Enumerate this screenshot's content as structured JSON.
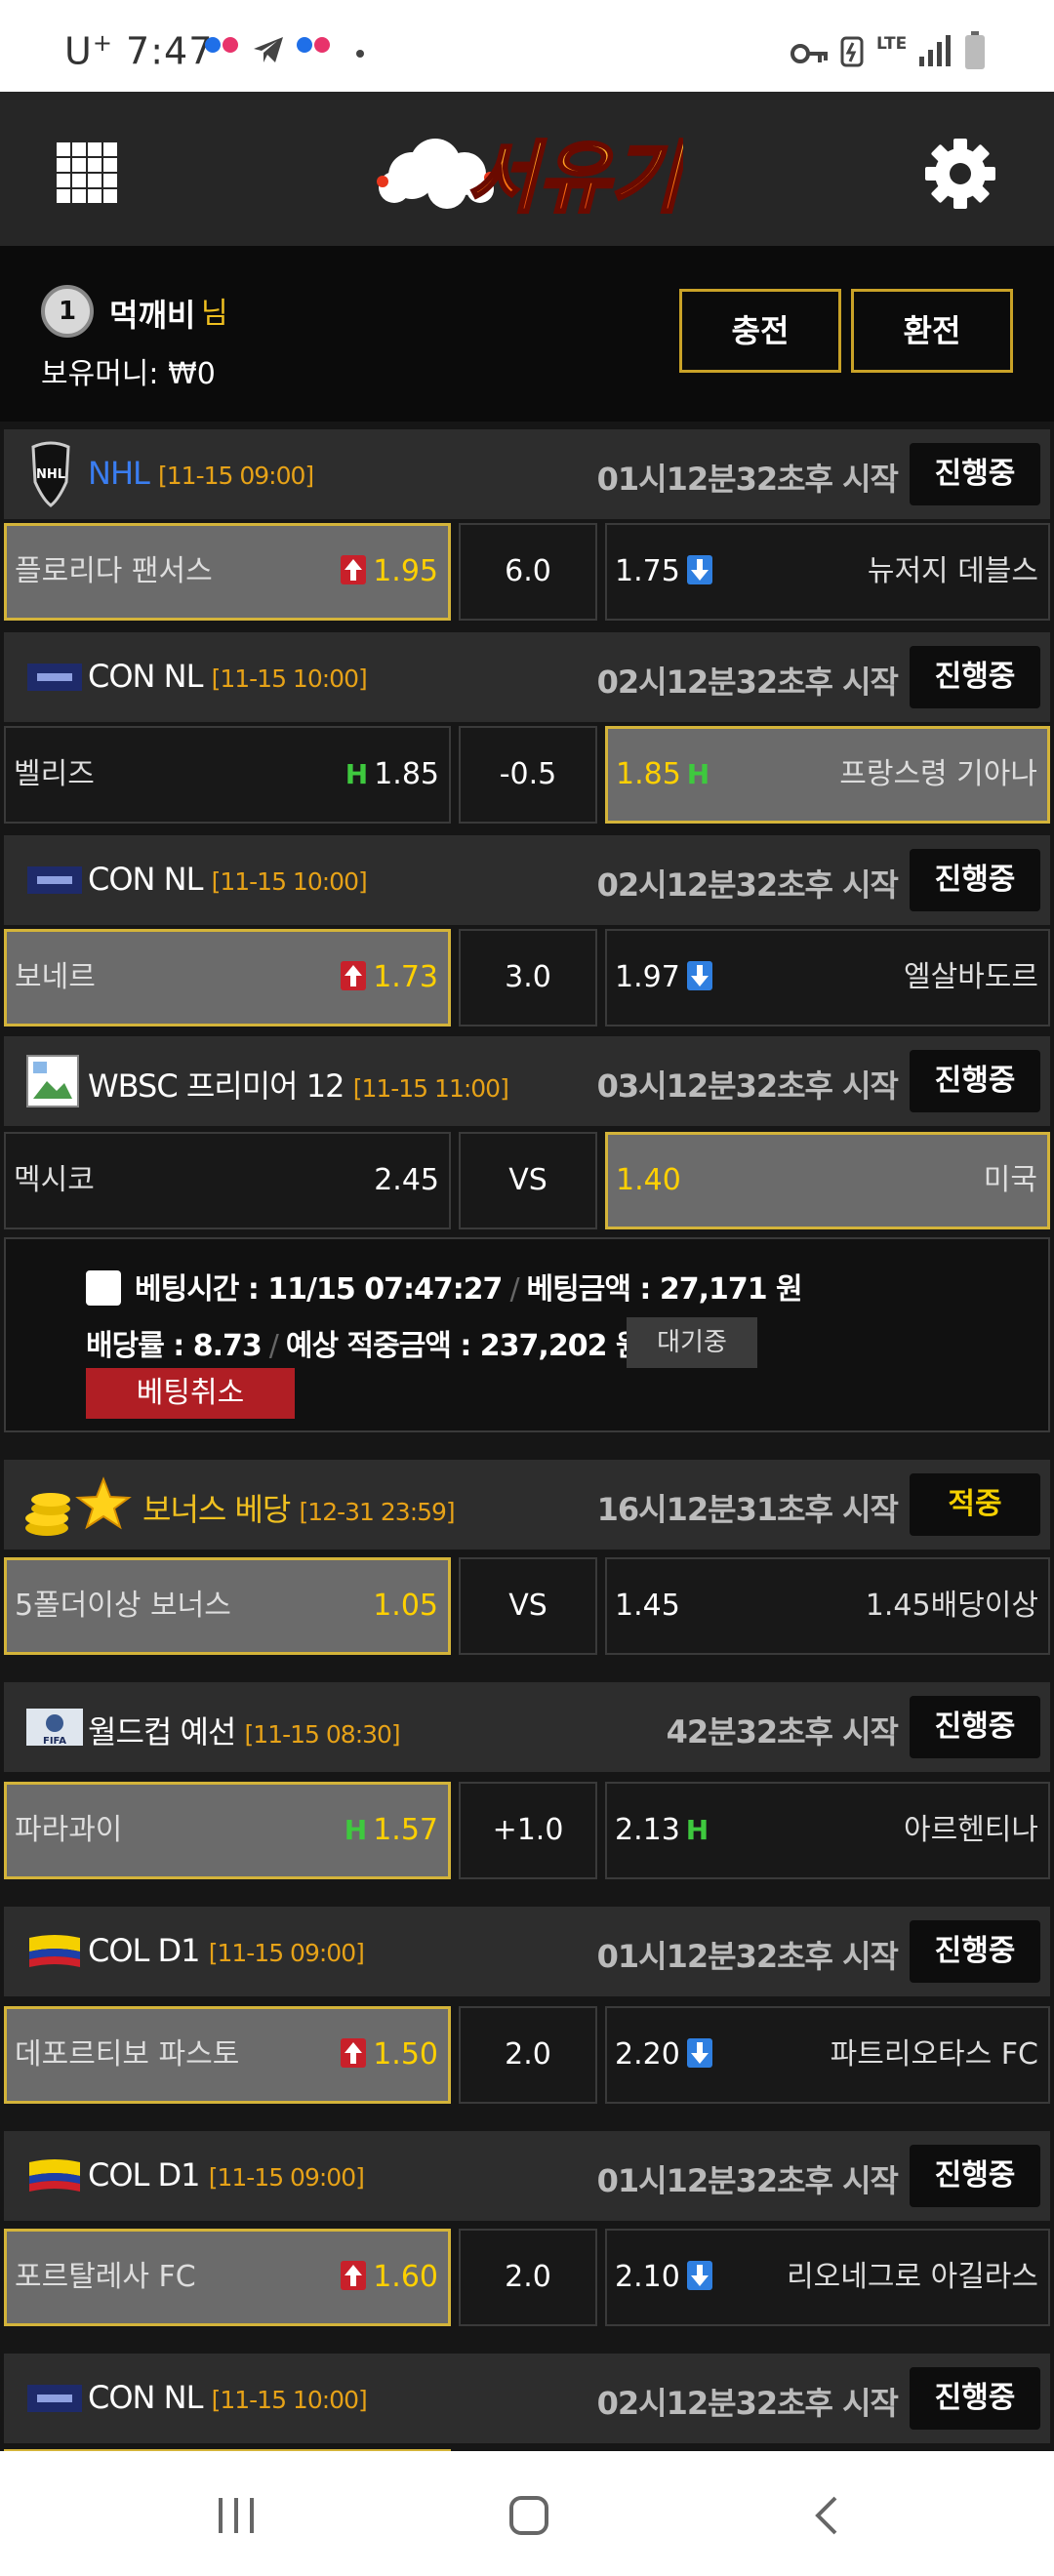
{
  "statusbar": {
    "carrier": "U",
    "carrier_plus": "+",
    "time": "7:47",
    "network": "LTE"
  },
  "header": {
    "logo_text": "서유기",
    "menu_icon": "grid-icon",
    "settings_icon": "gear-icon"
  },
  "user": {
    "rank": "1",
    "name": "먹깨비",
    "suffix": "님",
    "money_label": "보유머니:",
    "money_value": "₩0",
    "charge_label": "충전",
    "exchange_label": "환전"
  },
  "matches": [
    {
      "league": "NHL",
      "date": "[11-15 09:00]",
      "countdown": "01시12분32초후 시작",
      "status": "진행중",
      "home": "플로리다 팬서스",
      "home_odds": "1.95",
      "mid": "6.0",
      "away_odds": "1.75",
      "away": "뉴저지 데블스"
    },
    {
      "league": "CON NL",
      "date": "[11-15 10:00]",
      "countdown": "02시12분32초후 시작",
      "status": "진행중",
      "home": "벨리즈",
      "home_odds": "1.85",
      "mid": "-0.5",
      "away_odds": "1.85",
      "away": "프랑스령 기아나"
    },
    {
      "league": "CON NL",
      "date": "[11-15 10:00]",
      "countdown": "02시12분32초후 시작",
      "status": "진행중",
      "home": "보네르",
      "home_odds": "1.73",
      "mid": "3.0",
      "away_odds": "1.97",
      "away": "엘살바도르"
    },
    {
      "league": "WBSC 프리미어 12",
      "date": "[11-15 11:00]",
      "countdown": "03시12분32초후 시작",
      "status": "진행중",
      "home": "멕시코",
      "home_odds": "2.45",
      "mid": "VS",
      "away_odds": "1.40",
      "away": "미국"
    },
    {
      "league": "보너스 베당",
      "date": "[12-31 23:59]",
      "countdown": "16시12분31초후 시작",
      "status": "적중",
      "home": "5폴더이상 보너스",
      "home_odds": "1.05",
      "mid": "VS",
      "away_odds": "1.45",
      "away": "1.45배당이상"
    },
    {
      "league": "월드컵 예선",
      "date": "[11-15 08:30]",
      "countdown": "42분32초후 시작",
      "status": "진행중",
      "home": "파라과이",
      "home_odds": "1.57",
      "mid": "+1.0",
      "away_odds": "2.13",
      "away": "아르헨티나"
    },
    {
      "league": "COL D1",
      "date": "[11-15 09:00]",
      "countdown": "01시12분32초후 시작",
      "status": "진행중",
      "home": "데포르티보 파스토",
      "home_odds": "1.50",
      "mid": "2.0",
      "away_odds": "2.20",
      "away": "파트리오타스 FC"
    },
    {
      "league": "COL D1",
      "date": "[11-15 09:00]",
      "countdown": "01시12분32초후 시작",
      "status": "진행중",
      "home": "포르탈레사 FC",
      "home_odds": "1.60",
      "mid": "2.0",
      "away_odds": "2.10",
      "away": "리오네그로 아길라스"
    },
    {
      "league": "CON NL",
      "date": "[11-15 10:00]",
      "countdown": "02시12분32초후 시작",
      "status": "진행중"
    }
  ],
  "bet": {
    "time_label": "베팅시간 :",
    "time_value": "11/15 07:47:27",
    "amount_label": "베팅금액 :",
    "amount_value": "27,171 원",
    "rate_label": "배당률 :",
    "rate_value": "8.73",
    "expected_label": "예상 적중금액 :",
    "expected_value": "237,202 원",
    "wait_label": "대기중",
    "cancel_label": "베팅취소"
  },
  "colors": {
    "gold": "#c9a227",
    "date": "#e6a218",
    "nhl_blue": "#3a7df0",
    "cancel_red": "#b01e24",
    "handicap_green": "#3ec93e"
  }
}
